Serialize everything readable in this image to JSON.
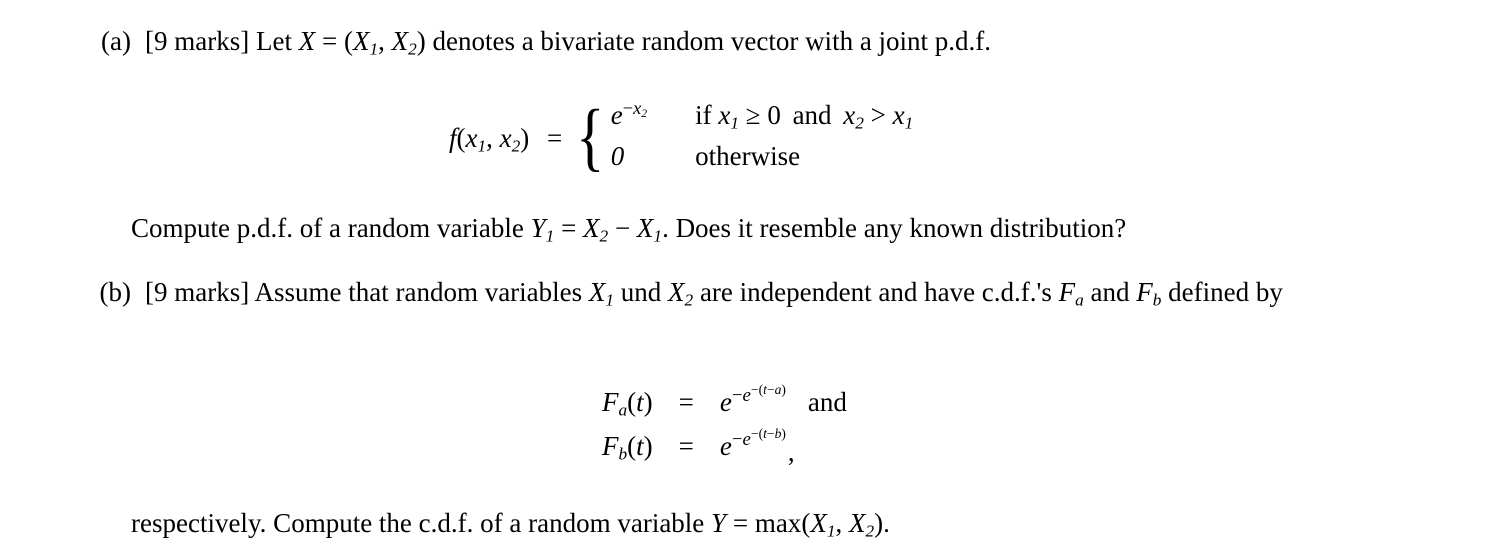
{
  "document": {
    "type": "exam-question",
    "background": "#ffffff",
    "text_color": "#000000"
  },
  "item_a": {
    "label": "(a)",
    "marks": "[9 marks]",
    "intro_before_X": "Let",
    "X_symbol": "X",
    "equals": "=",
    "vector_open": "(",
    "X1": "X",
    "X1_sub": "1",
    "vector_comma": ",",
    "X2": "X",
    "X2_sub": "2",
    "vector_close": ")",
    "intro_after": "denotes a bivariate random vector with a joint p.d.f.",
    "full_text": "[9 marks] Let X = (X₁, X₂) denotes a bivariate random vector with a joint p.d.f."
  },
  "pdf_equation": {
    "lhs_f": "f",
    "lhs_open": "(",
    "lhs_x1": "x",
    "lhs_x1_sub": "1",
    "lhs_comma": ",",
    "lhs_x2": "x",
    "lhs_x2_sub": "2",
    "lhs_close": ")",
    "equals": "=",
    "brace": "{",
    "case1_value_base": "e",
    "case1_value_exp_minus": "−",
    "case1_value_exp_var": "x",
    "case1_value_exp_sub": "2",
    "case1_condition_if": "if",
    "case1_cond_x1": "x",
    "case1_cond_x1_sub": "1",
    "case1_cond_rel1": "≥",
    "case1_cond_zero": "0",
    "case1_cond_and": "and",
    "case1_cond_x2": "x",
    "case1_cond_x2_sub": "2",
    "case1_cond_rel2": ">",
    "case1_cond_x1b": "x",
    "case1_cond_x1b_sub": "1",
    "case2_value": "0",
    "case2_condition": "otherwise",
    "full_text": "f(x₁, x₂) = { e^(−x₂) if x₁ ≥ 0 and x₂ > x₁ ; 0 otherwise }"
  },
  "compute_line": {
    "before": "Compute p.d.f. of a random variable",
    "Y": "Y",
    "Y_sub": "1",
    "equals": "=",
    "X2": "X",
    "X2_sub": "2",
    "minus": "−",
    "X1": "X",
    "X1_sub": "1",
    "after": ". Does it resemble any known distribution?",
    "full_text": "Compute p.d.f. of a random variable Y₁ = X₂ − X₁. Does it resemble any known distribution?"
  },
  "item_b": {
    "label": "(b)",
    "marks": "[9 marks]",
    "text1": "Assume that random variables",
    "X1": "X",
    "X1_sub": "1",
    "und": "und",
    "X2": "X",
    "X2_sub": "2",
    "text2": "are independent and have c.d.f.'s",
    "Fa": "F",
    "Fa_sub": "a",
    "and": "and",
    "Fb": "F",
    "Fb_sub": "b",
    "text3": "defined by",
    "full_text": "[9 marks] Assume that random variables X₁ und X₂ are independent and have c.d.f.'s F_a and F_b defined by"
  },
  "cdf_equations": {
    "rows": [
      {
        "lhs_F": "F",
        "lhs_sub": "a",
        "lhs_open": "(",
        "lhs_arg": "t",
        "lhs_close": ")",
        "relation": "=",
        "rhs_base": "e",
        "rhs_outer_minus": "−",
        "rhs_outer_base": "e",
        "rhs_inner_minus": "−",
        "rhs_inner_open": "(",
        "rhs_inner_t": "t",
        "rhs_inner_minus2": "−",
        "rhs_inner_param": "a",
        "rhs_inner_close": ")",
        "trailing": "and",
        "full_text": "F_a(t) = e^(−e^(−(t−a)))   and"
      },
      {
        "lhs_F": "F",
        "lhs_sub": "b",
        "lhs_open": "(",
        "lhs_arg": "t",
        "lhs_close": ")",
        "relation": "=",
        "rhs_base": "e",
        "rhs_outer_minus": "−",
        "rhs_outer_base": "e",
        "rhs_inner_minus": "−",
        "rhs_inner_open": "(",
        "rhs_inner_t": "t",
        "rhs_inner_minus2": "−",
        "rhs_inner_param": "b",
        "rhs_inner_close": ")",
        "trailing": ",",
        "full_text": "F_b(t) = e^(−e^(−(t−b))) ,"
      }
    ]
  },
  "respectively_line": {
    "before": "respectively. Compute the c.d.f. of a random variable",
    "Y": "Y",
    "equals": "=",
    "max": "max",
    "open": "(",
    "X1": "X",
    "X1_sub": "1",
    "comma": ",",
    "X2": "X",
    "X2_sub": "2",
    "close": ")",
    "period": ".",
    "full_text": "respectively. Compute the c.d.f. of a random variable Y = max(X₁, X₂)."
  }
}
